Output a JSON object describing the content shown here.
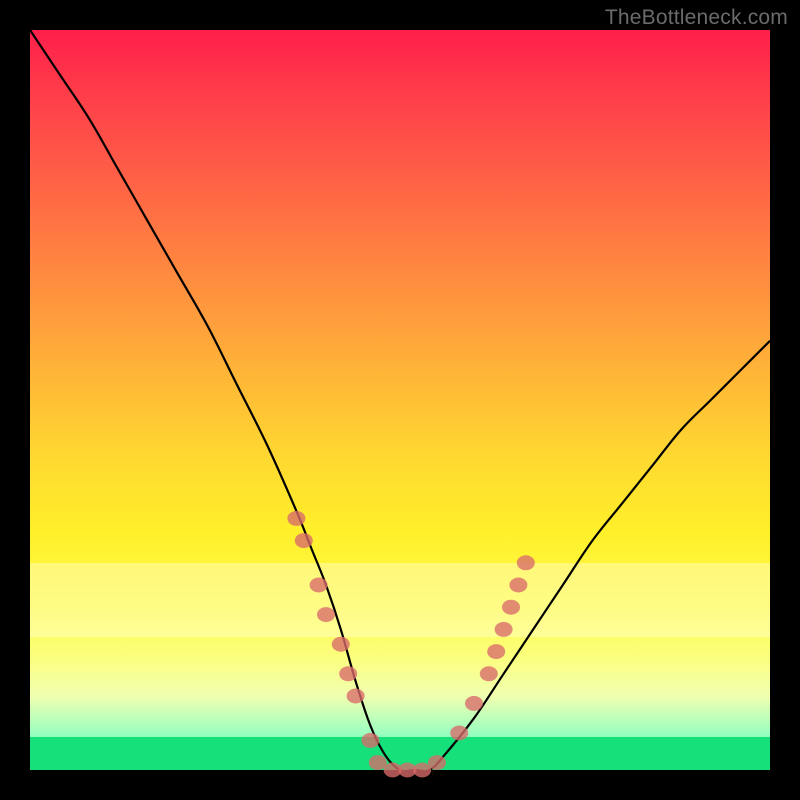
{
  "attribution": "TheBottleneck.com",
  "colors": {
    "frame": "#000000",
    "curve": "#000000",
    "marker": "#d86a6a",
    "gradient_top": "#ff1f4b",
    "gradient_bottom": "#1bff8f",
    "green_band": "#16e07a"
  },
  "chart_data": {
    "type": "line",
    "title": "",
    "xlabel": "",
    "ylabel": "",
    "xlim": [
      0,
      100
    ],
    "ylim": [
      0,
      100
    ],
    "grid": false,
    "legend": false,
    "series": [
      {
        "name": "bottleneck-curve",
        "x": [
          0,
          4,
          8,
          12,
          16,
          20,
          24,
          28,
          32,
          36,
          38,
          40,
          42,
          44,
          46,
          48,
          50,
          52,
          54,
          56,
          60,
          64,
          68,
          72,
          76,
          80,
          84,
          88,
          92,
          96,
          100
        ],
        "y": [
          100,
          94,
          88,
          81,
          74,
          67,
          60,
          52,
          44,
          35,
          30,
          25,
          19,
          12,
          6,
          2,
          0,
          0,
          0,
          2,
          7,
          13,
          19,
          25,
          31,
          36,
          41,
          46,
          50,
          54,
          58
        ]
      }
    ],
    "markers": [
      {
        "x": 36,
        "y": 34
      },
      {
        "x": 37,
        "y": 31
      },
      {
        "x": 39,
        "y": 25
      },
      {
        "x": 40,
        "y": 21
      },
      {
        "x": 42,
        "y": 17
      },
      {
        "x": 43,
        "y": 13
      },
      {
        "x": 44,
        "y": 10
      },
      {
        "x": 46,
        "y": 4
      },
      {
        "x": 47,
        "y": 1
      },
      {
        "x": 49,
        "y": 0
      },
      {
        "x": 51,
        "y": 0
      },
      {
        "x": 53,
        "y": 0
      },
      {
        "x": 55,
        "y": 1
      },
      {
        "x": 58,
        "y": 5
      },
      {
        "x": 60,
        "y": 9
      },
      {
        "x": 62,
        "y": 13
      },
      {
        "x": 63,
        "y": 16
      },
      {
        "x": 64,
        "y": 19
      },
      {
        "x": 65,
        "y": 22
      },
      {
        "x": 66,
        "y": 25
      },
      {
        "x": 67,
        "y": 28
      }
    ],
    "bands": {
      "pale_ymin": 18,
      "pale_ymax": 28,
      "green_ymax": 4.5
    }
  }
}
